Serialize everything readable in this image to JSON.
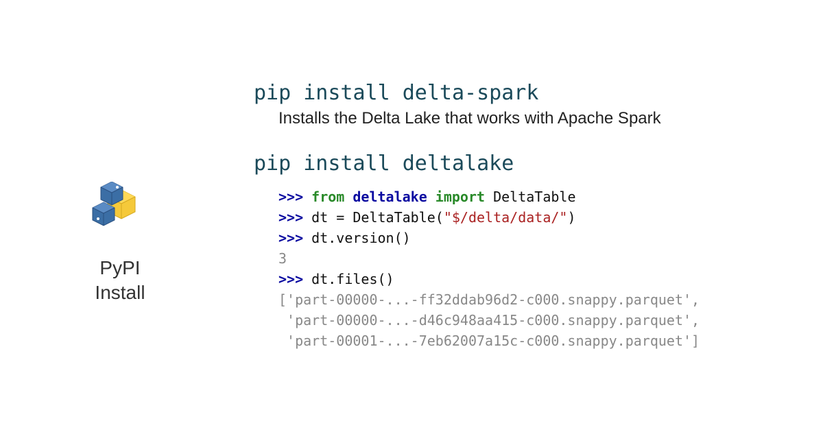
{
  "sidebar": {
    "label_line1": "PyPI",
    "label_line2": "Install"
  },
  "section1": {
    "command": "pip install delta-spark",
    "description": "Installs the Delta Lake that works with Apache Spark"
  },
  "section2": {
    "command": "pip install deltalake"
  },
  "code": {
    "prompt": ">>> ",
    "line1": {
      "from": "from ",
      "module": "deltalake",
      "import": " import ",
      "cls": "DeltaTable"
    },
    "line2": {
      "pre": "dt = DeltaTable(",
      "str": "\"$/delta/data/\"",
      "post": ")"
    },
    "line3": "dt.version()",
    "out3": "3",
    "line4": "dt.files()",
    "out4a": "['part-00000-...-ff32ddab96d2-c000.snappy.parquet',",
    "out4b": " 'part-00000-...-d46c948aa415-c000.snappy.parquet',",
    "out4c": " 'part-00001-...-7eb62007a15c-c000.snappy.parquet']"
  }
}
